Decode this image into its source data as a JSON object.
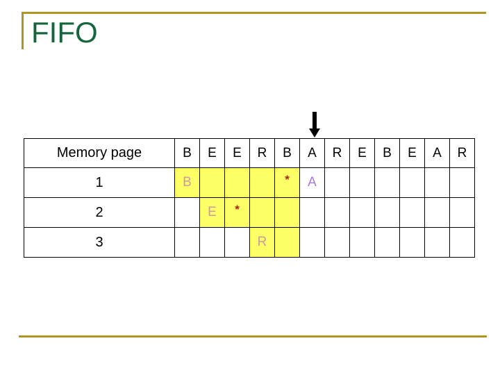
{
  "slide": {
    "title": "FIFO",
    "accent_color": "#b09621",
    "title_color": "#15663c"
  },
  "arrow": {
    "name": "current-reference-arrow",
    "points_to_column_index": 5,
    "direction": "down",
    "color": "#000000"
  },
  "table": {
    "row_label_header": "Memory page",
    "row_labels": [
      "1",
      "2",
      "3"
    ],
    "reference_string": [
      "B",
      "E",
      "E",
      "R",
      "B",
      "A",
      "R",
      "E",
      "B",
      "E",
      "A",
      "R"
    ],
    "highlight_color": "#ffff66",
    "page_glyph_color": "#cc99aa",
    "new_glyph_color": "#aa77dd",
    "star_color": "#aa2211",
    "rows": [
      {
        "label": "1",
        "cells": [
          {
            "text": "B",
            "highlight": true,
            "style": "page"
          },
          {
            "text": "",
            "highlight": true,
            "style": "page"
          },
          {
            "text": "",
            "highlight": true,
            "style": "page"
          },
          {
            "text": "",
            "highlight": true,
            "style": "page"
          },
          {
            "text": "*",
            "highlight": true,
            "style": "star"
          },
          {
            "text": "A",
            "highlight": false,
            "style": "new"
          },
          {
            "text": "",
            "highlight": false,
            "style": "page"
          },
          {
            "text": "",
            "highlight": false,
            "style": "page"
          },
          {
            "text": "",
            "highlight": false,
            "style": "page"
          },
          {
            "text": "",
            "highlight": false,
            "style": "page"
          },
          {
            "text": "",
            "highlight": false,
            "style": "page"
          },
          {
            "text": "",
            "highlight": false,
            "style": "page"
          }
        ]
      },
      {
        "label": "2",
        "cells": [
          {
            "text": "",
            "highlight": false,
            "style": "page"
          },
          {
            "text": "E",
            "highlight": true,
            "style": "page"
          },
          {
            "text": "*",
            "highlight": true,
            "style": "star"
          },
          {
            "text": "",
            "highlight": true,
            "style": "page"
          },
          {
            "text": "",
            "highlight": true,
            "style": "page"
          },
          {
            "text": "",
            "highlight": false,
            "style": "page"
          },
          {
            "text": "",
            "highlight": false,
            "style": "page"
          },
          {
            "text": "",
            "highlight": false,
            "style": "page"
          },
          {
            "text": "",
            "highlight": false,
            "style": "page"
          },
          {
            "text": "",
            "highlight": false,
            "style": "page"
          },
          {
            "text": "",
            "highlight": false,
            "style": "page"
          },
          {
            "text": "",
            "highlight": false,
            "style": "page"
          }
        ]
      },
      {
        "label": "3",
        "cells": [
          {
            "text": "",
            "highlight": false,
            "style": "page"
          },
          {
            "text": "",
            "highlight": false,
            "style": "page"
          },
          {
            "text": "",
            "highlight": false,
            "style": "page"
          },
          {
            "text": "R",
            "highlight": true,
            "style": "page"
          },
          {
            "text": "",
            "highlight": true,
            "style": "page"
          },
          {
            "text": "",
            "highlight": false,
            "style": "page"
          },
          {
            "text": "",
            "highlight": false,
            "style": "page"
          },
          {
            "text": "",
            "highlight": false,
            "style": "page"
          },
          {
            "text": "",
            "highlight": false,
            "style": "page"
          },
          {
            "text": "",
            "highlight": false,
            "style": "page"
          },
          {
            "text": "",
            "highlight": false,
            "style": "page"
          },
          {
            "text": "",
            "highlight": false,
            "style": "page"
          }
        ]
      }
    ]
  }
}
